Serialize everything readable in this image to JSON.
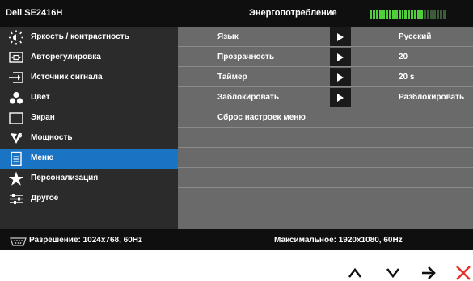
{
  "header": {
    "model": "Dell SE2416H",
    "energy_label": "Энергопотребление",
    "energy_level": 0.71
  },
  "sidebar": {
    "items": [
      {
        "label": "Яркость / контрастность",
        "icon": "brightness-icon"
      },
      {
        "label": "Авторегулировка",
        "icon": "auto-adjust-icon"
      },
      {
        "label": "Источник сигнала",
        "icon": "input-source-icon"
      },
      {
        "label": "Цвет",
        "icon": "color-icon"
      },
      {
        "label": "Экран",
        "icon": "display-icon"
      },
      {
        "label": "Мощность",
        "icon": "power-icon"
      },
      {
        "label": "Меню",
        "icon": "menu-icon",
        "active": true
      },
      {
        "label": "Персонализация",
        "icon": "star-icon"
      },
      {
        "label": "Другое",
        "icon": "sliders-icon"
      }
    ]
  },
  "menu": {
    "rows": [
      {
        "label": "Язык",
        "value": "Русский",
        "has_arrow": true
      },
      {
        "label": "Прозрачность",
        "value": "20",
        "has_arrow": true
      },
      {
        "label": "Таймер",
        "value": "20 s",
        "has_arrow": true
      },
      {
        "label": "Заблокировать",
        "value": "Разблокировать",
        "has_arrow": true
      },
      {
        "label": "Сброс настроек меню",
        "value": "",
        "has_arrow": false
      },
      {
        "label": "",
        "value": "",
        "has_arrow": false
      },
      {
        "label": "",
        "value": "",
        "has_arrow": false
      },
      {
        "label": "",
        "value": "",
        "has_arrow": false
      },
      {
        "label": "",
        "value": "",
        "has_arrow": false
      },
      {
        "label": "",
        "value": "",
        "has_arrow": false
      }
    ]
  },
  "status": {
    "resolution": "Разрешение:  1024x768, 60Hz",
    "maximum": "Максимальное:  1920x1080, 60Hz"
  },
  "controls": {
    "buttons": [
      {
        "name": "up-button",
        "icon": "chevron-up-icon"
      },
      {
        "name": "down-button",
        "icon": "chevron-down-icon"
      },
      {
        "name": "enter-button",
        "icon": "arrow-right-icon"
      },
      {
        "name": "exit-button",
        "icon": "close-icon"
      }
    ]
  },
  "colors": {
    "accent": "#1a73c3",
    "energy_on": "#4fd03a",
    "exit": "#e8312a"
  }
}
